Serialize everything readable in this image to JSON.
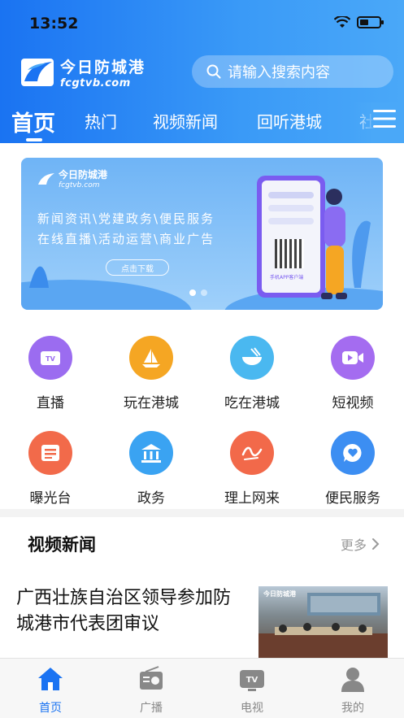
{
  "status": {
    "time": "13:52"
  },
  "header": {
    "logo_cn": "今日防城港",
    "logo_en": "fcgtvb.com",
    "search_placeholder": "请输入搜索内容"
  },
  "tabs": [
    {
      "label": "首页",
      "active": true
    },
    {
      "label": "热门"
    },
    {
      "label": "视频新闻"
    },
    {
      "label": "回听港城"
    },
    {
      "label": "社"
    }
  ],
  "banner": {
    "logo_cn": "今日防城港",
    "logo_en": "fcgtvb.com",
    "line1": "新闻资讯\\党建政务\\便民服务",
    "line2": "在线直播\\活动运营\\商业广告",
    "button": "点击下载",
    "phone_caption": "手机APP客户端"
  },
  "grid": [
    {
      "label": "直播",
      "icon": "tv-icon",
      "color": "#9b6cf0"
    },
    {
      "label": "玩在港城",
      "icon": "sailboat-icon",
      "color": "#f5a623"
    },
    {
      "label": "吃在港城",
      "icon": "bowl-icon",
      "color": "#4ab8f0"
    },
    {
      "label": "短视频",
      "icon": "video-camera-icon",
      "color": "#a46cf0"
    },
    {
      "label": "曝光台",
      "icon": "newspaper-icon",
      "color": "#f26a4a"
    },
    {
      "label": "政务",
      "icon": "government-building-icon",
      "color": "#3aa3f2"
    },
    {
      "label": "理上网来",
      "icon": "calligraphy-icon",
      "color": "#f2694a"
    },
    {
      "label": "便民服务",
      "icon": "chat-heart-icon",
      "color": "#3c8ef2"
    }
  ],
  "section": {
    "title": "视频新闻",
    "more": "更多"
  },
  "news": [
    {
      "title": "广西壮族自治区领导参加防城港市代表团审议",
      "thumb_logo": "今日防城港"
    }
  ],
  "tabbar": [
    {
      "label": "首页",
      "icon": "home-icon",
      "active": true
    },
    {
      "label": "广播",
      "icon": "radio-icon"
    },
    {
      "label": "电视",
      "icon": "tv-icon"
    },
    {
      "label": "我的",
      "icon": "user-icon"
    }
  ]
}
